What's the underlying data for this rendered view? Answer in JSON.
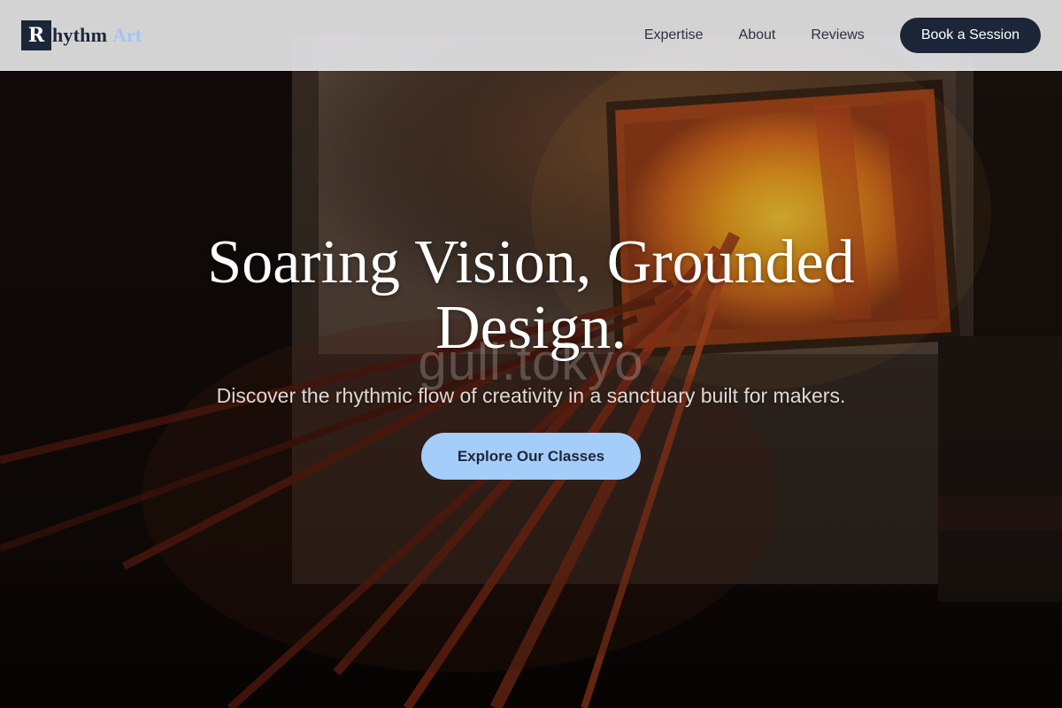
{
  "header": {
    "logo_mark": "R",
    "logo_word": "hythm",
    "logo_accent": "Art",
    "nav": [
      {
        "label": "Expertise"
      },
      {
        "label": "About"
      },
      {
        "label": "Reviews"
      }
    ],
    "cta_label": "Book a Session"
  },
  "hero": {
    "title_line1": "Soaring Vision, Grounded",
    "title_line2": "Design.",
    "watermark": "gull.tokyo",
    "subtitle": "Discover the rhythmic flow of creativity in a sanctuary built for makers.",
    "cta_label": "Explore Our Classes"
  },
  "colors": {
    "brand_dark": "#1d2638",
    "accent_light_blue": "#a5cdfa",
    "logo_accent": "#9cc6f7",
    "header_bg": "#e2e2e4"
  }
}
